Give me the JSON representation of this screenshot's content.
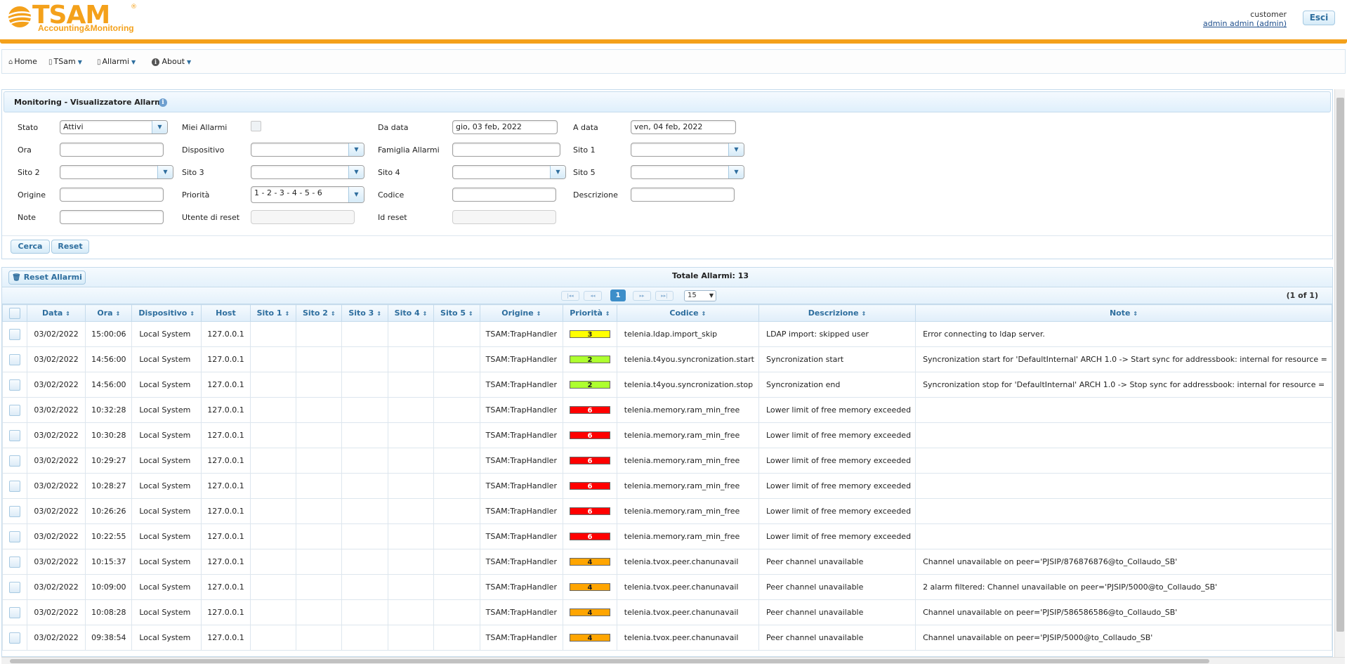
{
  "header": {
    "logo_text": "TSAM",
    "logo_sub": "Accounting&Monitoring",
    "logo_reg": "®",
    "role": "customer",
    "user": "admin admin (admin)",
    "exit_label": "Esci",
    "accent_color": "#f4a11b"
  },
  "menu": {
    "items": [
      {
        "label": "Home",
        "icon": "home-icon"
      },
      {
        "label": "TSam",
        "icon": "document-icon"
      },
      {
        "label": "Allarmi",
        "icon": "document-icon"
      },
      {
        "label": "About",
        "icon": "info-icon"
      }
    ]
  },
  "filters": {
    "title": "Monitoring - Visualizzatore Allarmi",
    "stato": {
      "label": "Stato",
      "value": "Attivi"
    },
    "miei": {
      "label": "Miei Allarmi"
    },
    "da_data": {
      "label": "Da data",
      "value": "gio, 03 feb, 2022"
    },
    "a_data": {
      "label": "A data",
      "value": "ven, 04 feb, 2022"
    },
    "ora": {
      "label": "Ora",
      "value": ""
    },
    "dispositivo": {
      "label": "Dispositivo",
      "value": ""
    },
    "famiglia": {
      "label": "Famiglia Allarmi",
      "value": ""
    },
    "sito1": {
      "label": "Sito 1",
      "value": ""
    },
    "sito2": {
      "label": "Sito 2",
      "value": ""
    },
    "sito3": {
      "label": "Sito 3",
      "value": ""
    },
    "sito4": {
      "label": "Sito 4",
      "value": ""
    },
    "sito5": {
      "label": "Sito 5",
      "value": ""
    },
    "origine": {
      "label": "Origine",
      "value": ""
    },
    "priorita": {
      "label": "Priorità",
      "value": "1 - 2 - 3 - 4 - 5 - 6"
    },
    "codice": {
      "label": "Codice",
      "value": ""
    },
    "descrizione": {
      "label": "Descrizione",
      "value": ""
    },
    "note": {
      "label": "Note",
      "value": ""
    },
    "utente_reset": {
      "label": "Utente di reset",
      "value": ""
    },
    "id_reset": {
      "label": "Id reset",
      "value": ""
    },
    "search_label": "Cerca",
    "reset_label": "Reset"
  },
  "grid": {
    "reset_alarms_label": "Reset Allarmi",
    "total_label": "Totale Allarmi: 13",
    "page_current": "1",
    "page_size": "15",
    "page_info": "(1 of 1)",
    "columns": [
      "Data",
      "Ora",
      "Dispositivo",
      "Host",
      "Sito 1",
      "Sito 2",
      "Sito 3",
      "Sito 4",
      "Sito 5",
      "Origine",
      "Priorità",
      "Codice",
      "Descrizione",
      "Note"
    ],
    "priority_colors": {
      "2": "#adff2f",
      "3": "#ffff00",
      "4": "#ffa500",
      "6": "#ff0000"
    },
    "rows": [
      {
        "data": "03/02/2022",
        "ora": "15:00:06",
        "dispositivo": "Local System",
        "host": "127.0.0.1",
        "origine": "TSAM:TrapHandler",
        "priorita": "3",
        "codice": "telenia.ldap.import_skip",
        "descrizione": "LDAP import: skipped user",
        "note": "Error connecting to ldap server."
      },
      {
        "data": "03/02/2022",
        "ora": "14:56:00",
        "dispositivo": "Local System",
        "host": "127.0.0.1",
        "origine": "TSAM:TrapHandler",
        "priorita": "2",
        "codice": "telenia.t4you.syncronization.start",
        "descrizione": "Syncronization start",
        "note": "Syncronization start for 'DefaultInternal' ARCH 1.0 -> Start sync for addressbook: internal for resource ="
      },
      {
        "data": "03/02/2022",
        "ora": "14:56:00",
        "dispositivo": "Local System",
        "host": "127.0.0.1",
        "origine": "TSAM:TrapHandler",
        "priorita": "2",
        "codice": "telenia.t4you.syncronization.stop",
        "descrizione": "Syncronization end",
        "note": "Syncronization stop for 'DefaultInternal' ARCH 1.0 -> Stop sync for addressbook: internal for resource ="
      },
      {
        "data": "03/02/2022",
        "ora": "10:32:28",
        "dispositivo": "Local System",
        "host": "127.0.0.1",
        "origine": "TSAM:TrapHandler",
        "priorita": "6",
        "codice": "telenia.memory.ram_min_free",
        "descrizione": "Lower limit of free memory exceeded",
        "note": ""
      },
      {
        "data": "03/02/2022",
        "ora": "10:30:28",
        "dispositivo": "Local System",
        "host": "127.0.0.1",
        "origine": "TSAM:TrapHandler",
        "priorita": "6",
        "codice": "telenia.memory.ram_min_free",
        "descrizione": "Lower limit of free memory exceeded",
        "note": ""
      },
      {
        "data": "03/02/2022",
        "ora": "10:29:27",
        "dispositivo": "Local System",
        "host": "127.0.0.1",
        "origine": "TSAM:TrapHandler",
        "priorita": "6",
        "codice": "telenia.memory.ram_min_free",
        "descrizione": "Lower limit of free memory exceeded",
        "note": ""
      },
      {
        "data": "03/02/2022",
        "ora": "10:28:27",
        "dispositivo": "Local System",
        "host": "127.0.0.1",
        "origine": "TSAM:TrapHandler",
        "priorita": "6",
        "codice": "telenia.memory.ram_min_free",
        "descrizione": "Lower limit of free memory exceeded",
        "note": ""
      },
      {
        "data": "03/02/2022",
        "ora": "10:26:26",
        "dispositivo": "Local System",
        "host": "127.0.0.1",
        "origine": "TSAM:TrapHandler",
        "priorita": "6",
        "codice": "telenia.memory.ram_min_free",
        "descrizione": "Lower limit of free memory exceeded",
        "note": ""
      },
      {
        "data": "03/02/2022",
        "ora": "10:22:55",
        "dispositivo": "Local System",
        "host": "127.0.0.1",
        "origine": "TSAM:TrapHandler",
        "priorita": "6",
        "codice": "telenia.memory.ram_min_free",
        "descrizione": "Lower limit of free memory exceeded",
        "note": ""
      },
      {
        "data": "03/02/2022",
        "ora": "10:15:37",
        "dispositivo": "Local System",
        "host": "127.0.0.1",
        "origine": "TSAM:TrapHandler",
        "priorita": "4",
        "codice": "telenia.tvox.peer.chanunavail",
        "descrizione": "Peer channel unavailable",
        "note": "Channel unavailable on peer='PJSIP/876876876@to_Collaudo_SB'"
      },
      {
        "data": "03/02/2022",
        "ora": "10:09:00",
        "dispositivo": "Local System",
        "host": "127.0.0.1",
        "origine": "TSAM:TrapHandler",
        "priorita": "4",
        "codice": "telenia.tvox.peer.chanunavail",
        "descrizione": "Peer channel unavailable",
        "note": "2 alarm filtered: Channel unavailable on peer='PJSIP/5000@to_Collaudo_SB'"
      },
      {
        "data": "03/02/2022",
        "ora": "10:08:28",
        "dispositivo": "Local System",
        "host": "127.0.0.1",
        "origine": "TSAM:TrapHandler",
        "priorita": "4",
        "codice": "telenia.tvox.peer.chanunavail",
        "descrizione": "Peer channel unavailable",
        "note": "Channel unavailable on peer='PJSIP/586586586@to_Collaudo_SB'"
      },
      {
        "data": "03/02/2022",
        "ora": "09:38:54",
        "dispositivo": "Local System",
        "host": "127.0.0.1",
        "origine": "TSAM:TrapHandler",
        "priorita": "4",
        "codice": "telenia.tvox.peer.chanunavail",
        "descrizione": "Peer channel unavailable",
        "note": "Channel unavailable on peer='PJSIP/5000@to_Collaudo_SB'"
      }
    ]
  }
}
